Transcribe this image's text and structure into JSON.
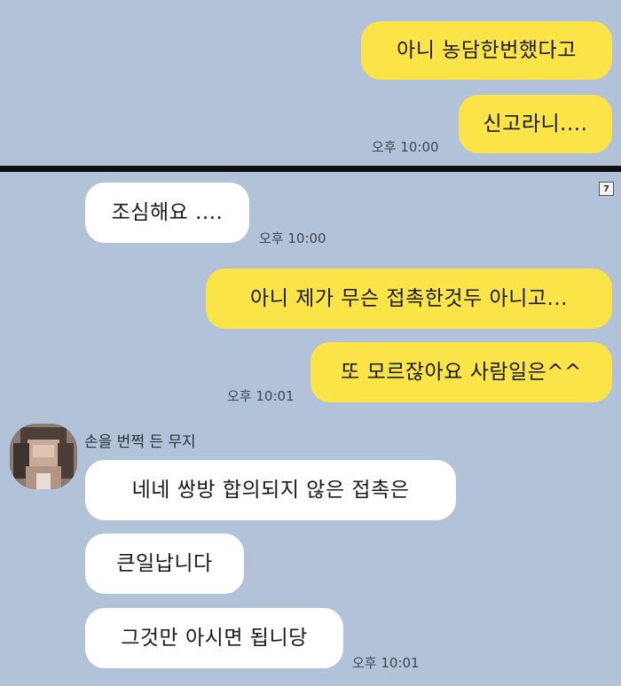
{
  "chat_top": {
    "messages": [
      {
        "text": "아니 농담한번했다고"
      },
      {
        "text": "신고라니...."
      }
    ],
    "time": "오후 10:00"
  },
  "chat_bottom": {
    "badge": "7",
    "msg_1": {
      "text": "조심해요 ....",
      "time": "오후 10:00"
    },
    "msg_2": {
      "text": "아니 제가 무슨 접촉한것두 아니고..."
    },
    "msg_3": {
      "text": "또 모르잖아요 사람일은^^",
      "time": "오후 10:01"
    },
    "sender_name": "손을 번쩍 든 무지",
    "reply_1": {
      "text": "네네 쌍방 합의되지 않은 접촉은"
    },
    "reply_2": {
      "text": "큰일납니다"
    },
    "reply_3": {
      "text": "그것만 아시면 됩니당",
      "time": "오후 10:01"
    }
  },
  "colors": {
    "chat_background": "#b2c3d9",
    "outgoing_bubble": "#fbe448",
    "incoming_bubble": "#ffffff"
  }
}
